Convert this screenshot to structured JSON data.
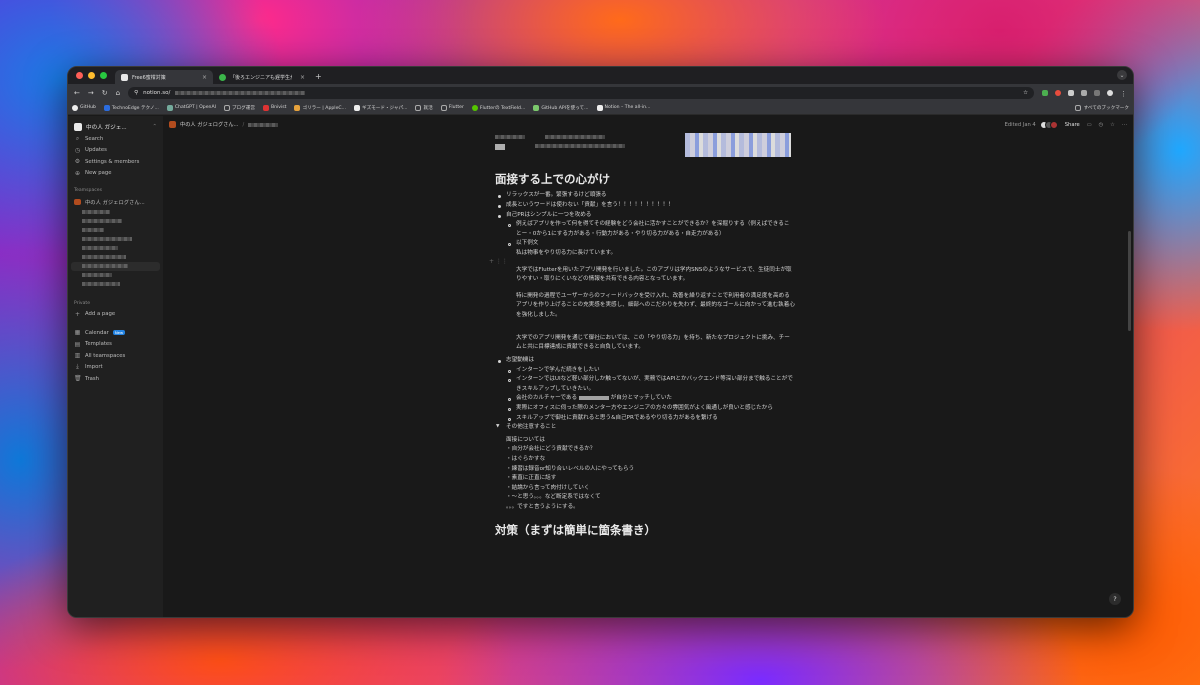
{
  "browser": {
    "tabs": [
      {
        "label": "Free6蜜柑対策",
        "active": true
      },
      {
        "label": "「後ろエンジニアも遅学生が紹介",
        "active": false
      }
    ],
    "url": "notion.so/",
    "bookmarks": [
      "GitHub",
      "TechnoEdge テクノ...",
      "ChatGPT | OpenAI",
      "ブログ運営",
      "Bnivist",
      "ゴリラー | AppleC...",
      "ギズモード・ジャパ...",
      "就活",
      "Flutter",
      "Flutterの TextField...",
      "GitHub APIを使って...",
      "Notion – The all-in..."
    ],
    "bookmarks_right": "すべてのブックマーク"
  },
  "sidebar": {
    "workspace": "中の人 ガジェ...",
    "items": [
      {
        "icon": "search-icon",
        "label": "Search"
      },
      {
        "icon": "clock-icon",
        "label": "Updates"
      },
      {
        "icon": "gear-icon",
        "label": "Settings & members"
      },
      {
        "icon": "plus-icon",
        "label": "New page"
      }
    ],
    "teamspaces_label": "Teamspaces",
    "teamspace": "中の人 ガジェログさん...",
    "private_label": "Private",
    "add_page": "Add a page",
    "bottom": [
      {
        "icon": "calendar-icon",
        "label": "Calendar",
        "badge": "New"
      },
      {
        "icon": "template-icon",
        "label": "Templates"
      },
      {
        "icon": "teamspace-icon",
        "label": "All teamspaces"
      },
      {
        "icon": "import-icon",
        "label": "Import"
      },
      {
        "icon": "trash-icon",
        "label": "Trash"
      }
    ]
  },
  "topbar": {
    "breadcrumb": "中の人 ガジェログさん...",
    "edited": "Edited Jan 4",
    "share": "Share"
  },
  "doc": {
    "heading1": "面接する上での心がけ",
    "b1": "リラックスが一番。緊張するけど頑張る",
    "b2": "成長というワードは使わない「貢献」を言う！！！！！！！！！！",
    "b3": "自己PRはシンプルに一つを攻める",
    "b3_1": "例えばアプリを作って何を得てその経験をどう会社に活かすことができるか？を深掘りする（例えばできることー・0から1にする力がある・行動力がある・やり切る力がある・自走力がある）",
    "b3_2": "以下例文",
    "b3_2_sub": "私は物事をやり切る力に長けています。",
    "p1": "大学ではFlutterを用いたアプリ開発を行いました。このアプリは学内SNSのようなサービスで、生徒同士が取りやすい・取りにくいなどの情報を共有できる内容となっています。",
    "p2": "特に開発の過程でユーザーからのフィードバックを受け入れ、改善を繰り返すことで利用者の満足度を高めるアプリを作り上げることの充実感を実感し、細部へのこだわりを失わず、最終的なゴールに向かって進む執着心を強化しました。",
    "p3": "大学でのアプリ開発を通じて御社においては、この「やり切る力」を持ち、新たなプロジェクトに挑み、チームと共に目標達成に貢献できると自負しています。",
    "b4": "志望動機は",
    "b4_1": "インターンで学んだ続きをしたい",
    "b4_2": "インターンではUIなど軽い部分しか触ってないが、実務ではAPIとかバックエンド等深い部分まで触ることができスキルアップしていきたい。",
    "b4_3a": "会社のカルチャーである",
    "b4_3b": "が自分とマッチしていた",
    "b4_4": "実際にオフィスに伺った際のメンター方やエンジニアの方々の雰囲気がよく風通しが良いと感じたから",
    "b4_5": "スキルアップで御社に貢献れると思う&自己PRであるやり切る力があるを繋げる",
    "toggle": "その他注意すること",
    "notes_title": "面接については",
    "notes": [
      "・自分が会社にどう貢献できるか？",
      "・はぐらかすな",
      "・練習は録音or知り合いレベルの人にやってもらう",
      "・素直に正直に話す",
      "・結論から言って肉付けしていく",
      "・〜と思う。。。など断定系ではなくて",
      "。。。ですと言うようにする。"
    ],
    "heading2": "対策（まずは簡単に箇条書き）"
  },
  "help": "?"
}
